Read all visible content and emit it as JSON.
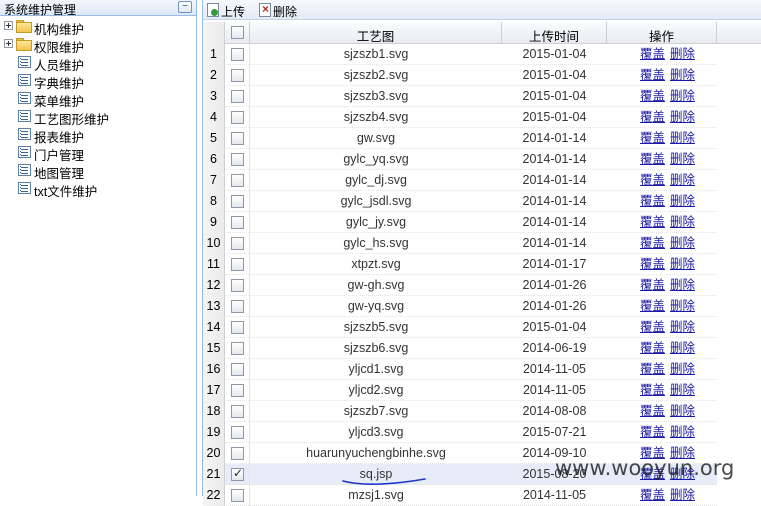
{
  "sidebar": {
    "title": "系统维护管理",
    "collapse_glyph": "−",
    "items": [
      {
        "label": "机构维护",
        "type": "folder"
      },
      {
        "label": "权限维护",
        "type": "folder"
      },
      {
        "label": "人员维护",
        "type": "leaf"
      },
      {
        "label": "字典维护",
        "type": "leaf"
      },
      {
        "label": "菜单维护",
        "type": "leaf"
      },
      {
        "label": "工艺图形维护",
        "type": "leaf"
      },
      {
        "label": "报表维护",
        "type": "leaf"
      },
      {
        "label": "门户管理",
        "type": "leaf"
      },
      {
        "label": "地图管理",
        "type": "leaf"
      },
      {
        "label": "txt文件维护",
        "type": "leaf"
      }
    ]
  },
  "toolbar": {
    "upload_label": "上传",
    "delete_label": "删除"
  },
  "grid": {
    "headers": {
      "name": "工艺图",
      "time": "上传时间",
      "ops": "操作"
    },
    "op_labels": {
      "cover": "覆盖",
      "delete": "删除"
    },
    "rows": [
      {
        "num": "1",
        "name": "sjzszb1.svg",
        "time": "2015-01-04",
        "checked": false
      },
      {
        "num": "2",
        "name": "sjzszb2.svg",
        "time": "2015-01-04",
        "checked": false
      },
      {
        "num": "3",
        "name": "sjzszb3.svg",
        "time": "2015-01-04",
        "checked": false
      },
      {
        "num": "4",
        "name": "sjzszb4.svg",
        "time": "2015-01-04",
        "checked": false
      },
      {
        "num": "5",
        "name": "gw.svg",
        "time": "2014-01-14",
        "checked": false
      },
      {
        "num": "6",
        "name": "gylc_yq.svg",
        "time": "2014-01-14",
        "checked": false
      },
      {
        "num": "7",
        "name": "gylc_dj.svg",
        "time": "2014-01-14",
        "checked": false
      },
      {
        "num": "8",
        "name": "gylc_jsdl.svg",
        "time": "2014-01-14",
        "checked": false
      },
      {
        "num": "9",
        "name": "gylc_jy.svg",
        "time": "2014-01-14",
        "checked": false
      },
      {
        "num": "10",
        "name": "gylc_hs.svg",
        "time": "2014-01-14",
        "checked": false
      },
      {
        "num": "11",
        "name": "xtpzt.svg",
        "time": "2014-01-17",
        "checked": false
      },
      {
        "num": "12",
        "name": "gw-gh.svg",
        "time": "2014-01-26",
        "checked": false
      },
      {
        "num": "13",
        "name": "gw-yq.svg",
        "time": "2014-01-26",
        "checked": false
      },
      {
        "num": "14",
        "name": "sjzszb5.svg",
        "time": "2015-01-04",
        "checked": false
      },
      {
        "num": "15",
        "name": "sjzszb6.svg",
        "time": "2014-06-19",
        "checked": false
      },
      {
        "num": "16",
        "name": "yljcd1.svg",
        "time": "2014-11-05",
        "checked": false
      },
      {
        "num": "17",
        "name": "yljcd2.svg",
        "time": "2014-11-05",
        "checked": false
      },
      {
        "num": "18",
        "name": "sjzszb7.svg",
        "time": "2014-08-08",
        "checked": false
      },
      {
        "num": "19",
        "name": "yljcd3.svg",
        "time": "2015-07-21",
        "checked": false
      },
      {
        "num": "20",
        "name": "huarunyuchengbinhe.svg",
        "time": "2014-09-10",
        "checked": false
      },
      {
        "num": "21",
        "name": "sq.jsp",
        "time": "2015-08-20",
        "checked": true
      },
      {
        "num": "22",
        "name": "mzsj1.svg",
        "time": "2014-11-05",
        "checked": false
      }
    ]
  },
  "watermark": "www.wooyun.org",
  "colors": {
    "link": "#1a1aa6",
    "panel_border": "#99bbe8",
    "selected_row": "#e6edf9",
    "annotation": "#1f35c8"
  }
}
